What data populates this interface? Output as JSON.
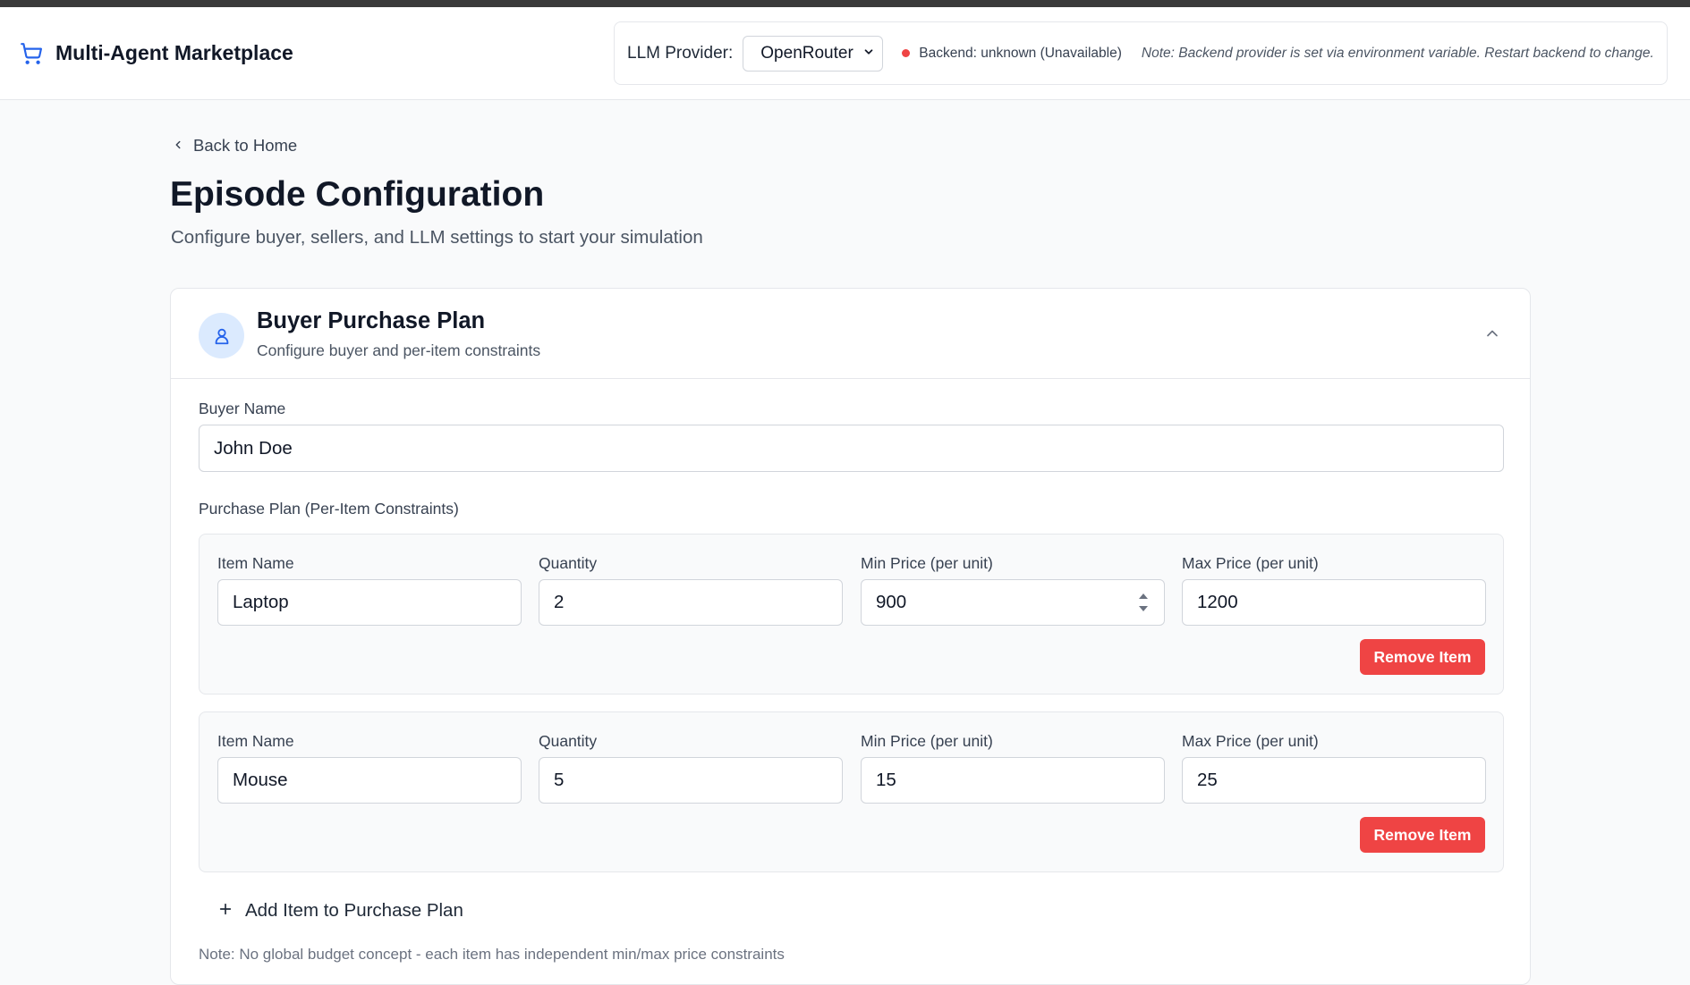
{
  "header": {
    "app_title": "Multi-Agent Marketplace",
    "provider_label": "LLM Provider:",
    "provider_selected": "OpenRouter",
    "backend_status": "Backend: unknown (Unavailable)",
    "backend_status_color": "#ef4444",
    "note": "Note: Backend provider is set via environment variable. Restart backend to change."
  },
  "nav": {
    "back_label": "Back to Home"
  },
  "page": {
    "title": "Episode Configuration",
    "subtitle": "Configure buyer, sellers, and LLM settings to start your simulation"
  },
  "buyer_card": {
    "title": "Buyer Purchase Plan",
    "description": "Configure buyer and per-item constraints",
    "icon": "user-icon",
    "collapse_icon": "chevron-up-icon",
    "buyer_name_label": "Buyer Name",
    "buyer_name_value": "John Doe",
    "plan_label": "Purchase Plan (Per-Item Constraints)",
    "items": [
      {
        "item_name_label": "Item Name",
        "item_name": "Laptop",
        "quantity_label": "Quantity",
        "quantity": "2",
        "min_price_label": "Min Price (per unit)",
        "min_price": "900",
        "max_price_label": "Max Price (per unit)",
        "max_price": "1200",
        "remove_label": "Remove Item"
      },
      {
        "item_name_label": "Item Name",
        "item_name": "Mouse",
        "quantity_label": "Quantity",
        "quantity": "5",
        "min_price_label": "Min Price (per unit)",
        "min_price": "15",
        "max_price_label": "Max Price (per unit)",
        "max_price": "25",
        "remove_label": "Remove Item"
      }
    ],
    "add_item_label": "Add Item to Purchase Plan",
    "footnote": "Note: No global budget concept - each item has independent min/max price constraints"
  },
  "colors": {
    "accent": "#2563eb",
    "danger": "#ef4444",
    "icon_bg": "#dbeafe"
  }
}
